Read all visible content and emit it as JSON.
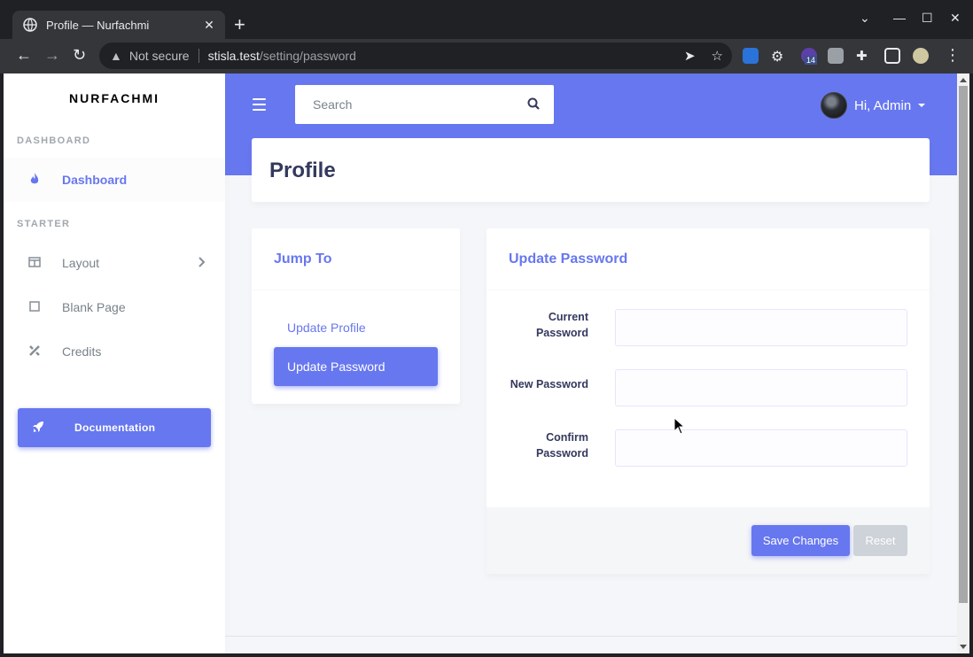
{
  "browser": {
    "tab_title": "Profile — Nurfachmi",
    "url_warning": "Not secure",
    "url_host": "stisla.test",
    "url_path": "/setting/password",
    "extension_badge": "14"
  },
  "sidebar": {
    "brand": "NURFACHMI",
    "sections": [
      {
        "header": "DASHBOARD"
      },
      {
        "header": "STARTER"
      }
    ],
    "items": [
      {
        "label": "Dashboard",
        "icon": "fire-icon",
        "active": true
      },
      {
        "label": "Layout",
        "icon": "columns-icon",
        "has_submenu": true
      },
      {
        "label": "Blank Page",
        "icon": "square-icon"
      },
      {
        "label": "Credits",
        "icon": "pencil-ruler-icon"
      }
    ],
    "doc_button": "Documentation"
  },
  "navbar": {
    "search_placeholder": "Search",
    "user_greeting": "Hi, Admin"
  },
  "page": {
    "title": "Profile"
  },
  "jump_to": {
    "title": "Jump To",
    "links": [
      "Update Profile",
      "Update Password"
    ],
    "active_link": "Update Password"
  },
  "password_form": {
    "title": "Update Password",
    "fields": [
      {
        "label_line1": "Current",
        "label_line2": "Password",
        "value": ""
      },
      {
        "label_line1": "New Password",
        "label_line2": "",
        "value": ""
      },
      {
        "label_line1": "Confirm",
        "label_line2": "Password",
        "value": ""
      }
    ],
    "save_label": "Save Changes",
    "reset_label": "Reset"
  },
  "colors": {
    "primary": "#6777ef",
    "background": "#f4f6f9",
    "title": "#34395e"
  }
}
